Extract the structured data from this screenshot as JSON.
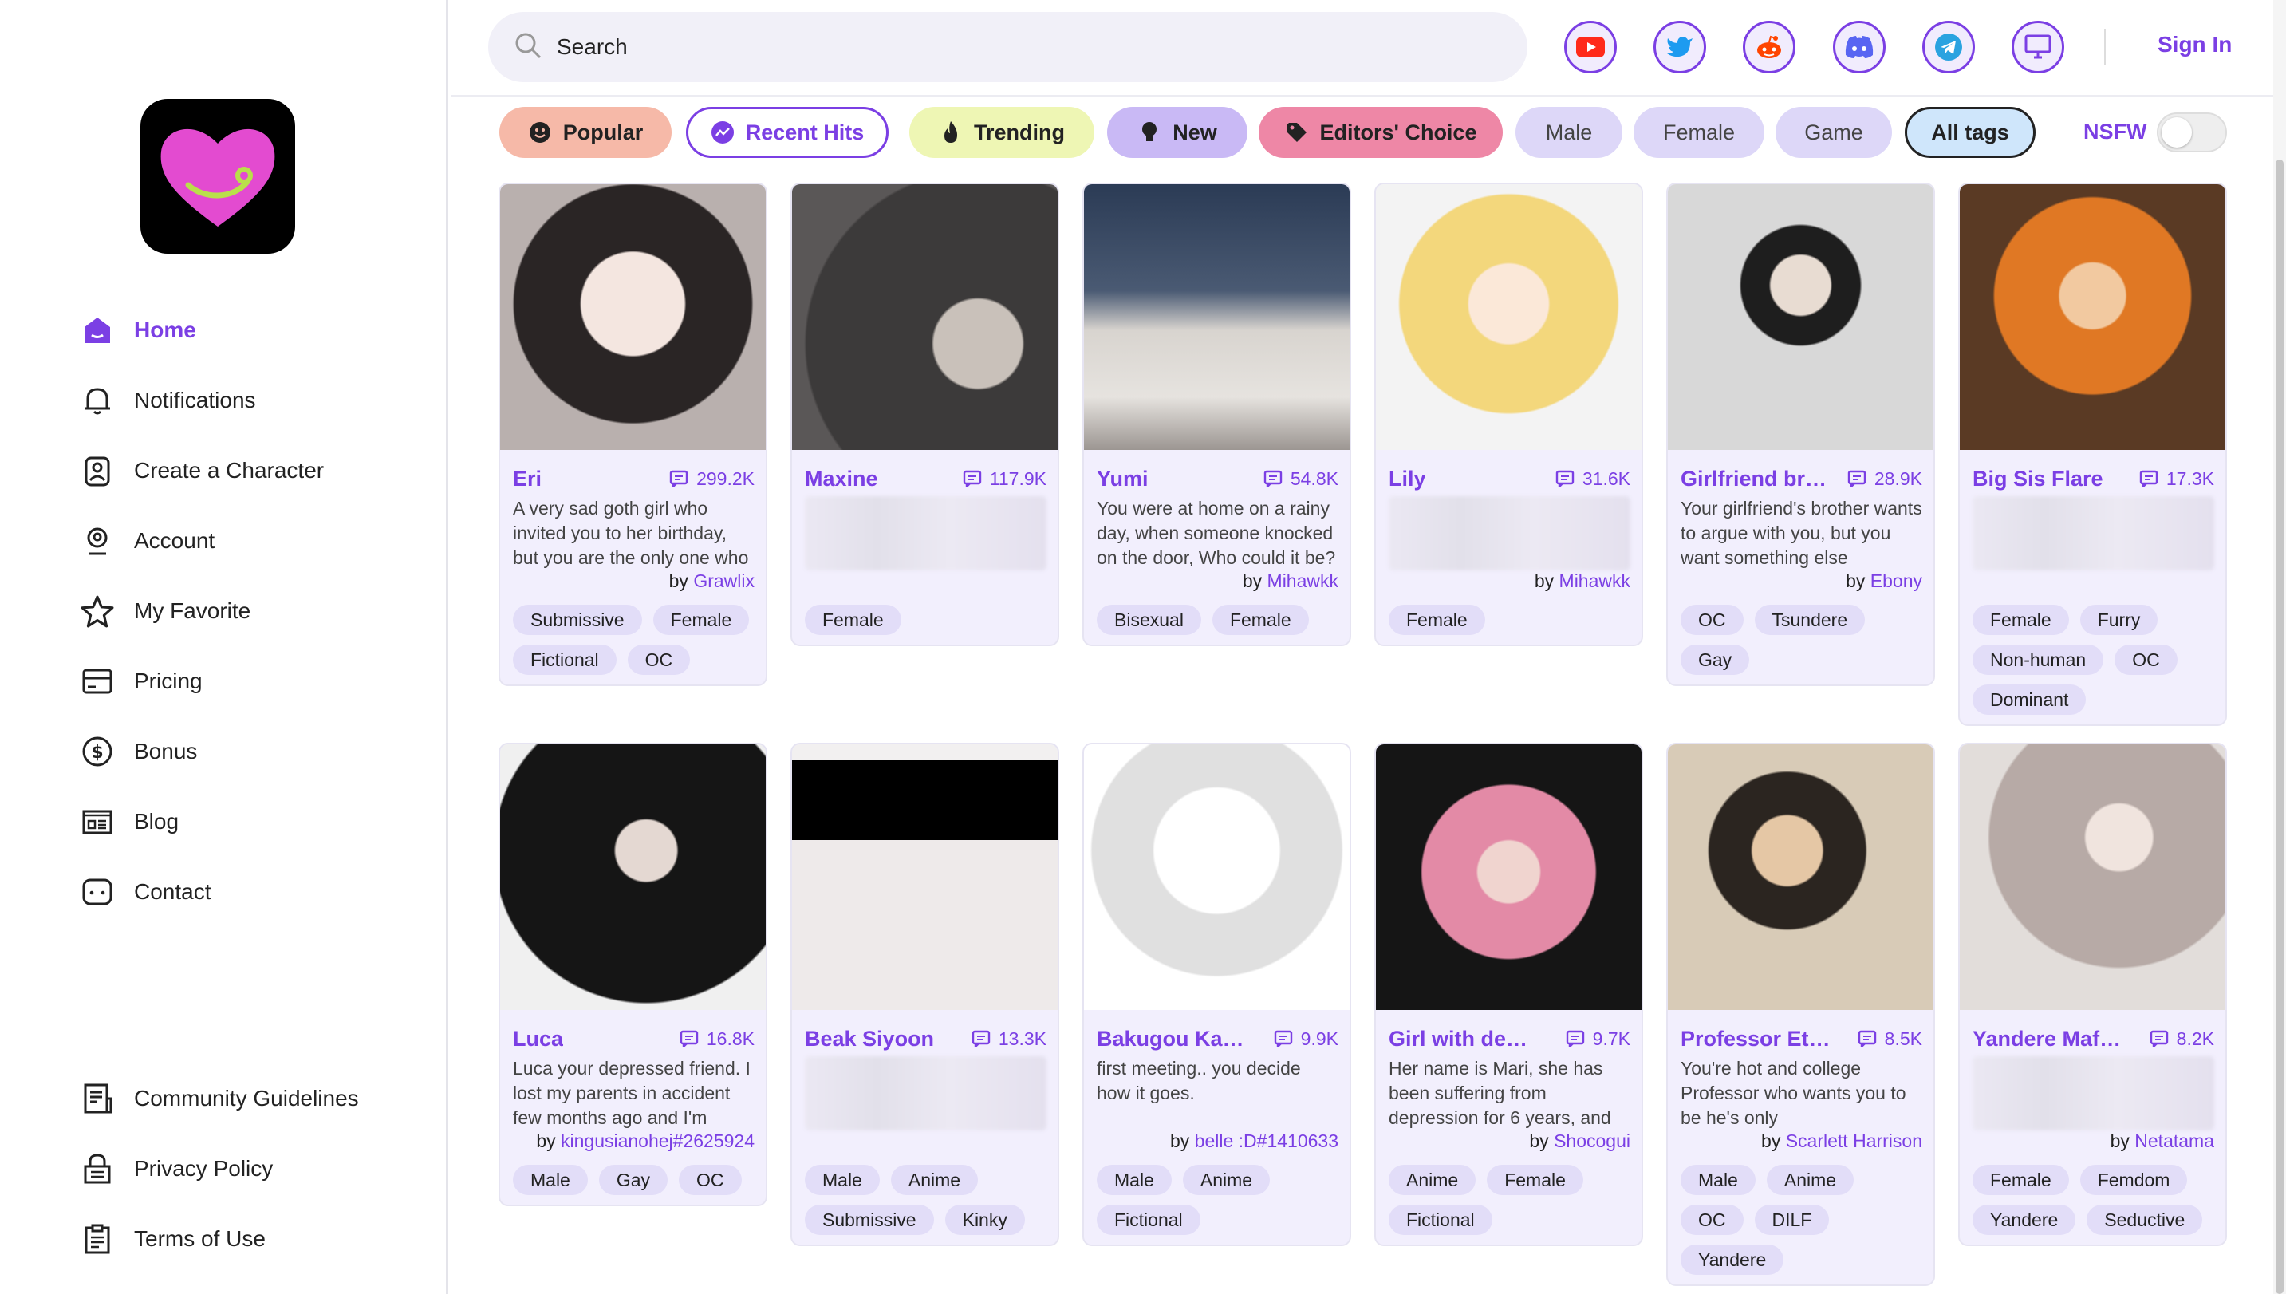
{
  "sidebar": {
    "nav": [
      {
        "label": "Home",
        "icon": "home-icon",
        "active": true
      },
      {
        "label": "Notifications",
        "icon": "bell-icon"
      },
      {
        "label": "Create a Character",
        "icon": "create-character-icon"
      },
      {
        "label": "Account",
        "icon": "account-icon"
      },
      {
        "label": "My Favorite",
        "icon": "star-icon"
      },
      {
        "label": "Pricing",
        "icon": "card-icon"
      },
      {
        "label": "Bonus",
        "icon": "dollar-icon"
      },
      {
        "label": "Blog",
        "icon": "blog-icon"
      },
      {
        "label": "Contact",
        "icon": "chat-icon"
      }
    ],
    "footer": [
      {
        "label": "Community Guidelines",
        "icon": "document-icon"
      },
      {
        "label": "Privacy Policy",
        "icon": "lock-icon"
      },
      {
        "label": "Terms of Use",
        "icon": "clipboard-icon"
      }
    ]
  },
  "header": {
    "search_placeholder": "Search",
    "social": [
      "youtube-icon",
      "twitter-icon",
      "reddit-icon",
      "discord-icon",
      "telegram-icon",
      "desktop-icon"
    ],
    "signin": "Sign In"
  },
  "filters": {
    "chips": [
      {
        "label": "Popular",
        "icon": "smile-icon"
      },
      {
        "label": "Recent Hits",
        "icon": "trend-icon"
      },
      {
        "label": "Trending",
        "icon": "fire-icon"
      },
      {
        "label": "New",
        "icon": "bulb-icon"
      },
      {
        "label": "Editors' Choice",
        "icon": "tag-icon"
      },
      {
        "label": "Male"
      },
      {
        "label": "Female"
      },
      {
        "label": "Game"
      },
      {
        "label": "All tags",
        "active": true
      }
    ],
    "nsfw_label": "NSFW",
    "nsfw_on": false
  },
  "colors": {
    "accent": "#7b3fe4",
    "card_bg": "#f2effd",
    "tag_bg": "#e2ddf8"
  },
  "cards": [
    {
      "name": "Eri",
      "count": "299.2K",
      "desc": "A very sad goth girl who invited you to her birthday, but you are the only one who",
      "by": "by ",
      "author": "Grawlix",
      "tags": [
        "Submissive",
        "Female",
        "Fictional",
        "OC"
      ]
    },
    {
      "name": "Maxine",
      "count": "117.9K",
      "desc": "",
      "by": "",
      "author": "",
      "tags": [
        "Female"
      ]
    },
    {
      "name": "Yumi",
      "count": "54.8K",
      "desc": "You were at home on a rainy day, when someone knocked on the door, Who could it be?",
      "by": "by ",
      "author": "Mihawkk",
      "tags": [
        "Bisexual",
        "Female"
      ]
    },
    {
      "name": "Lily",
      "count": "31.6K",
      "desc": "",
      "by": "by ",
      "author": "Mihawkk",
      "tags": [
        "Female"
      ]
    },
    {
      "name": "Girlfriend brother",
      "count": "28.9K",
      "desc": "Your girlfriend's brother wants to argue with you, but you want something else",
      "by": "by ",
      "author": "Ebony",
      "tags": [
        "OC",
        "Tsundere",
        "Gay"
      ]
    },
    {
      "name": "Big Sis Flare",
      "count": "17.3K",
      "desc": "",
      "by": "",
      "author": "",
      "tags": [
        "Female",
        "Furry",
        "Non-human",
        "OC",
        "Dominant"
      ]
    },
    {
      "name": "Luca",
      "count": "16.8K",
      "desc": "Luca your depressed friend. I lost my parents in accident few months ago and I'm",
      "by": "by ",
      "author": "kingusianohej#2625924",
      "tags": [
        "Male",
        "Gay",
        "OC"
      ]
    },
    {
      "name": "Beak Siyoon",
      "count": "13.3K",
      "desc": "",
      "by": "",
      "author": "",
      "tags": [
        "Male",
        "Anime",
        "Submissive",
        "Kinky"
      ]
    },
    {
      "name": "Bakugou Katsuki",
      "count": "9.9K",
      "desc": "first meeting.. you decide how it goes.",
      "by": "by ",
      "author": "belle :D#1410633",
      "tags": [
        "Male",
        "Anime",
        "Fictional"
      ]
    },
    {
      "name": "Girl with depres...",
      "count": "9.7K",
      "desc": "Her name is Mari, she has been suffering from depression for 6 years, and",
      "by": "by ",
      "author": "Shocogui",
      "tags": [
        "Anime",
        "Female",
        "Fictional"
      ]
    },
    {
      "name": "Professor Ethan",
      "count": "8.5K",
      "desc": "You're hot and college Professor who wants you to be he's only",
      "by": "by ",
      "author": "Scarlett Harrison",
      "tags": [
        "Male",
        "Anime",
        "OC",
        "DILF",
        "Yandere"
      ]
    },
    {
      "name": "Yandere Mafia ...",
      "count": "8.2K",
      "desc": "",
      "by": "by ",
      "author": "Netatama",
      "tags": [
        "Female",
        "Femdom",
        "Yandere",
        "Seductive"
      ]
    }
  ]
}
